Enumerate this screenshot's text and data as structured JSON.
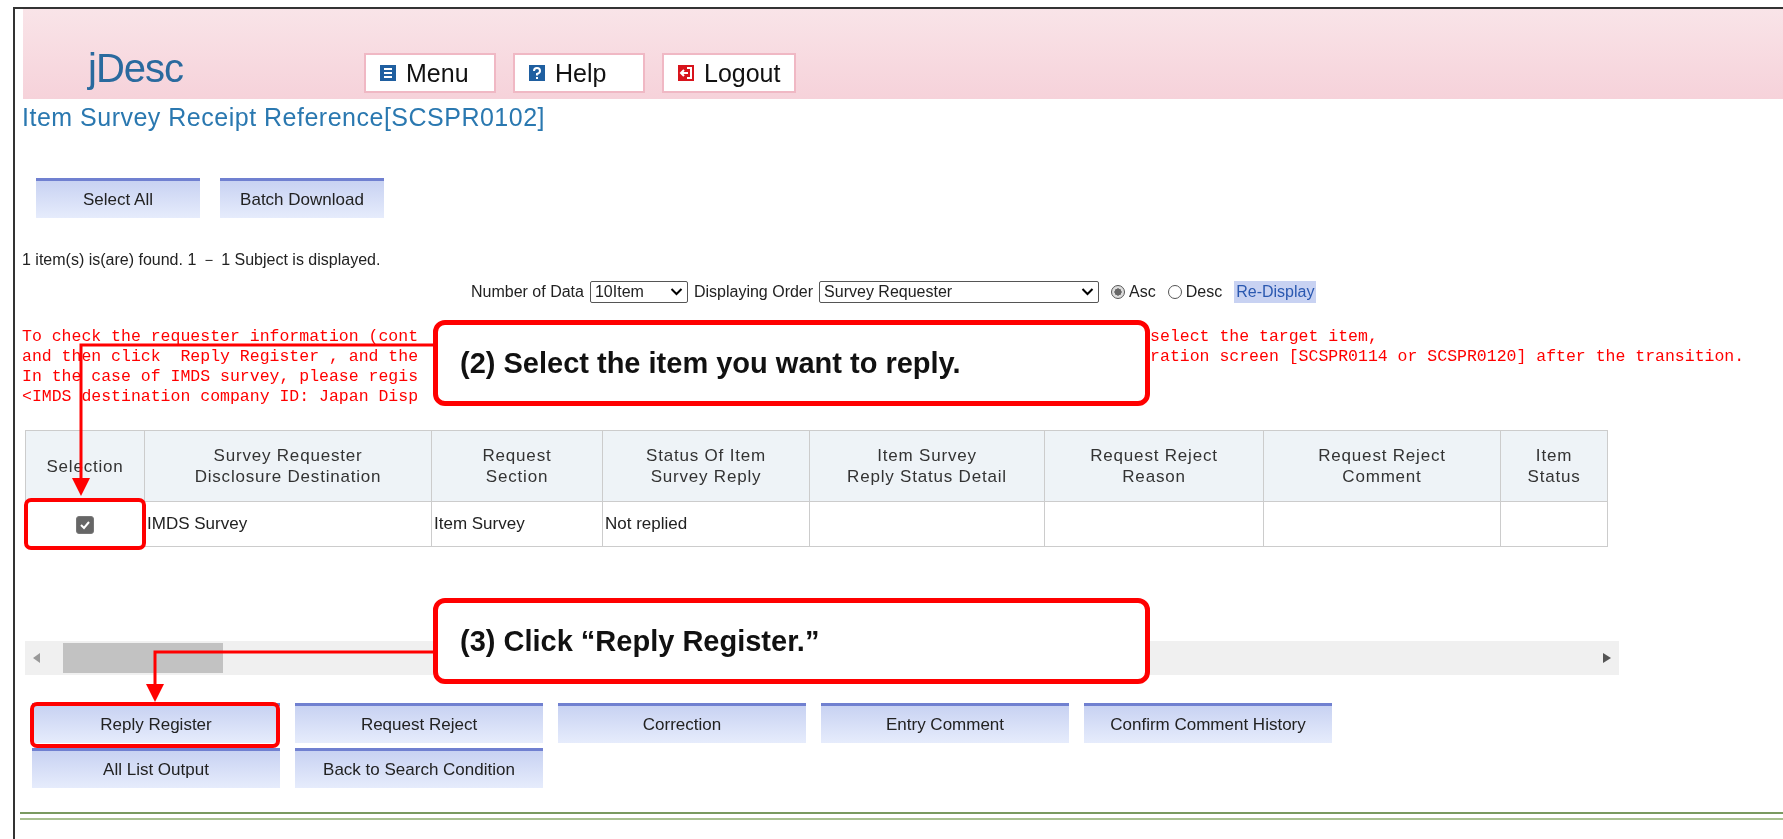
{
  "header": {
    "logo": "jDesc",
    "nav_buttons": [
      {
        "kind": "menu",
        "label": "Menu"
      },
      {
        "kind": "help",
        "label": "Help"
      },
      {
        "kind": "logout",
        "label": "Logout"
      }
    ]
  },
  "page_title": "Item Survey Receipt Reference[SCSPR0102]",
  "top_buttons": [
    "Select All",
    "Batch Download"
  ],
  "result_text": "1 item(s) is(are) found. 1 － 1 Subject is displayed.",
  "display_options": {
    "number_label": "Number of Data",
    "number_value": "10Item",
    "order_label": "Displaying Order",
    "order_value": "Survey Requester",
    "sort": [
      {
        "label": "Asc",
        "selected": true
      },
      {
        "label": "Desc",
        "selected": false
      }
    ],
    "redisplay": "Re-Display"
  },
  "notice_lines": [
    {
      "left": "To check the requester information (cont",
      "right": "select the target item,"
    },
    {
      "left": "and then click  Reply Register , and the",
      "right": "ration screen [SCSPR0114 or SCSPR0120] after the transition."
    },
    {
      "left": "In the case of IMDS survey, please regis"
    },
    {
      "left": "<IMDS destination company ID: Japan Disp"
    }
  ],
  "table": {
    "columns": [
      "Selection",
      "Survey Requester\nDisclosure Destination",
      "Request\nSection",
      "Status Of Item\nSurvey Reply",
      "Item Survey\nReply Status Detail",
      "Request Reject\nReason",
      "Request Reject\nComment",
      "Item\nStatus"
    ],
    "rows": [
      {
        "checked": true,
        "cells": [
          "",
          "IMDS Survey",
          "Item Survey",
          "Not replied",
          "",
          "",
          "",
          ""
        ]
      }
    ]
  },
  "action_buttons": [
    [
      "Reply Register",
      "Request Reject",
      "Correction",
      "Entry Comment",
      "Confirm Comment History"
    ],
    [
      "All List Output",
      "Back to Search Condition"
    ]
  ],
  "annotations": [
    {
      "text": "(2) Select the item you want to reply."
    },
    {
      "text": "(3) Click “Reply Register.”"
    }
  ]
}
